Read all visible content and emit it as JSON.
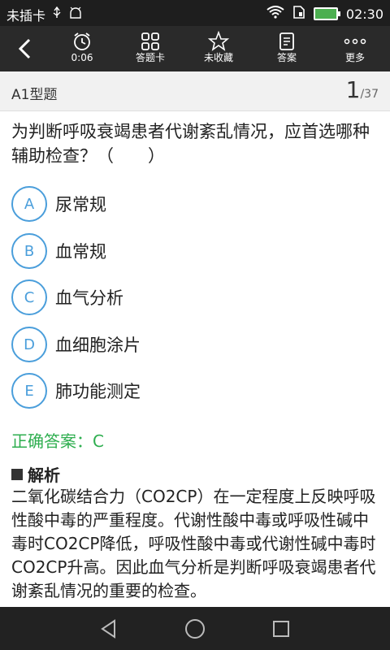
{
  "status_bar": {
    "carrier": "未插卡",
    "time": "02:30"
  },
  "toolbar": {
    "items": [
      {
        "label": "0:06",
        "icon": "alarm-clock-icon"
      },
      {
        "label": "答题卡",
        "icon": "grid-icon"
      },
      {
        "label": "未收藏",
        "icon": "star-icon"
      },
      {
        "label": "答案",
        "icon": "document-icon"
      },
      {
        "label": "更多",
        "icon": "more-dots-icon"
      }
    ]
  },
  "subheader": {
    "question_type": "A1型题",
    "current": "1",
    "total": "/37"
  },
  "question": {
    "text": "为判断呼吸衰竭患者代谢紊乱情况，应首选哪种辅助检查？（　　）",
    "options": [
      {
        "letter": "A",
        "text": "尿常规"
      },
      {
        "letter": "B",
        "text": "血常规"
      },
      {
        "letter": "C",
        "text": "血气分析"
      },
      {
        "letter": "D",
        "text": "血细胞涂片"
      },
      {
        "letter": "E",
        "text": "肺功能测定"
      }
    ]
  },
  "answer": {
    "text": "正确答案：C",
    "color": "#2eae4f"
  },
  "analysis": {
    "title": "解析",
    "text": "二氧化碳结合力（CO2CP）在一定程度上反映呼吸性酸中毒的严重程度。代谢性酸中毒或呼吸性碱中毒时CO2CP降低，呼吸性酸中毒或代谢性碱中毒时CO2CP升高。因此血气分析是判断呼吸衰竭患者代谢紊乱情况的重要的检查。"
  },
  "colors": {
    "accent": "#4a9edb",
    "toolbar": "#2a2a2a",
    "answer": "#2eae4f"
  }
}
